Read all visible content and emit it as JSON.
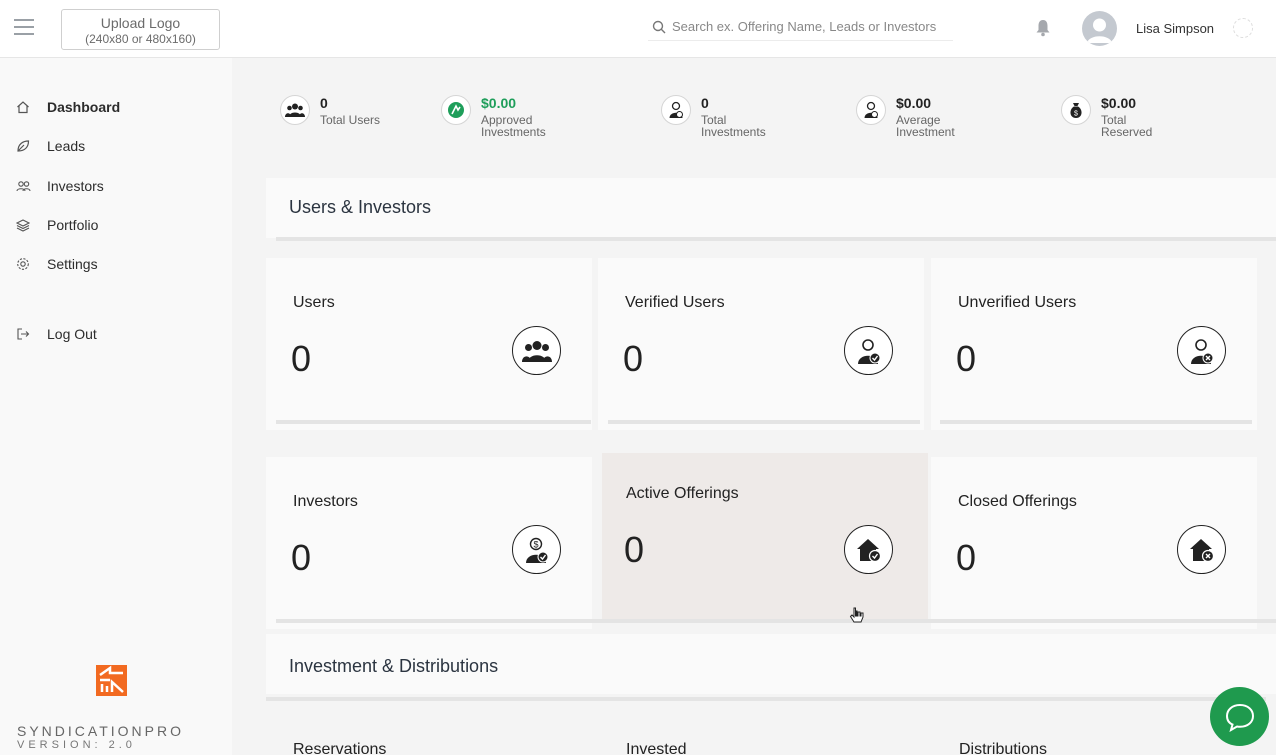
{
  "header": {
    "upload_logo_label": "Upload Logo",
    "upload_logo_hint": "(240x80 or 480x160)",
    "search_placeholder": "Search ex. Offering Name, Leads or Investors",
    "user_name": "Lisa Simpson"
  },
  "sidebar": {
    "items": [
      {
        "label": "Dashboard",
        "icon": "home-icon",
        "active": true
      },
      {
        "label": "Leads",
        "icon": "leaf-icon"
      },
      {
        "label": "Investors",
        "icon": "users-icon"
      },
      {
        "label": "Portfolio",
        "icon": "layers-icon"
      },
      {
        "label": "Settings",
        "icon": "gear-icon"
      },
      {
        "label": "Log Out",
        "icon": "logout-icon"
      }
    ],
    "brand_name": "SYNDICATIONPRO",
    "brand_version": "VERSION: 2.0"
  },
  "stats": [
    {
      "value": "0",
      "label": "Total Users",
      "icon": "users-group-icon"
    },
    {
      "value": "$0.00",
      "label": "Approved Investments",
      "icon": "approved-investment-icon"
    },
    {
      "value": "0",
      "label": "Total Investments",
      "icon": "investor-icon"
    },
    {
      "value": "$0.00",
      "label": "Average Investment",
      "icon": "investor-icon"
    },
    {
      "value": "$0.00",
      "label": "Total Reserved",
      "icon": "money-bag-icon"
    }
  ],
  "sections": {
    "users_investors": "Users & Investors",
    "investment_distributions": "Investment & Distributions"
  },
  "cards": [
    {
      "title": "Users",
      "value": "0",
      "icon": "users-group-icon"
    },
    {
      "title": "Verified Users",
      "value": "0",
      "icon": "verified-user-icon"
    },
    {
      "title": "Unverified Users",
      "value": "0",
      "icon": "unverified-user-icon"
    },
    {
      "title": "Investors",
      "value": "0",
      "icon": "investor-dollar-icon"
    },
    {
      "title": "Active Offerings",
      "value": "0",
      "icon": "active-offering-icon"
    },
    {
      "title": "Closed Offerings",
      "value": "0",
      "icon": "closed-offering-icon"
    }
  ],
  "partial_cards": [
    "Reservations",
    "Invested",
    "Distributions"
  ],
  "colors": {
    "accent_green": "#1e9e5a",
    "chat_green": "#1f9a4e",
    "brand_orange": "#f26a21"
  }
}
